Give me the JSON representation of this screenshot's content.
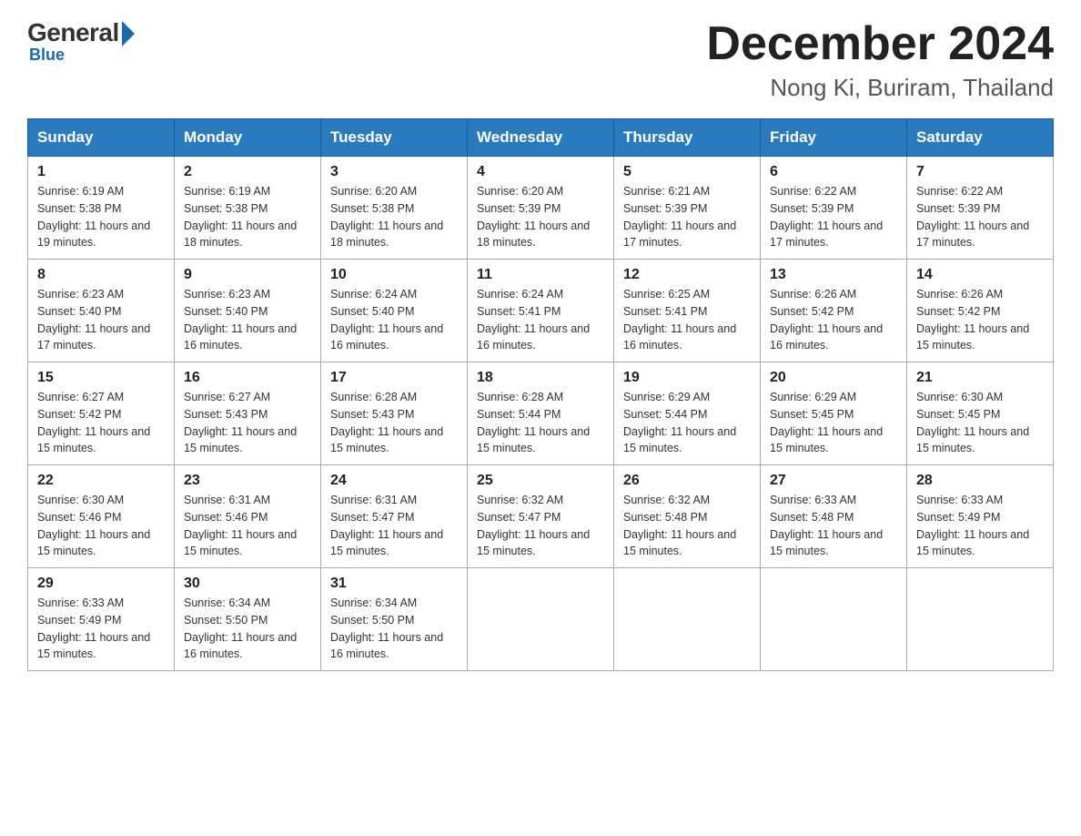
{
  "logo": {
    "general": "General",
    "blue": "Blue"
  },
  "header": {
    "month": "December 2024",
    "location": "Nong Ki, Buriram, Thailand"
  },
  "weekdays": [
    "Sunday",
    "Monday",
    "Tuesday",
    "Wednesday",
    "Thursday",
    "Friday",
    "Saturday"
  ],
  "weeks": [
    [
      {
        "day": "1",
        "sunrise": "6:19 AM",
        "sunset": "5:38 PM",
        "daylight": "11 hours and 19 minutes."
      },
      {
        "day": "2",
        "sunrise": "6:19 AM",
        "sunset": "5:38 PM",
        "daylight": "11 hours and 18 minutes."
      },
      {
        "day": "3",
        "sunrise": "6:20 AM",
        "sunset": "5:38 PM",
        "daylight": "11 hours and 18 minutes."
      },
      {
        "day": "4",
        "sunrise": "6:20 AM",
        "sunset": "5:39 PM",
        "daylight": "11 hours and 18 minutes."
      },
      {
        "day": "5",
        "sunrise": "6:21 AM",
        "sunset": "5:39 PM",
        "daylight": "11 hours and 17 minutes."
      },
      {
        "day": "6",
        "sunrise": "6:22 AM",
        "sunset": "5:39 PM",
        "daylight": "11 hours and 17 minutes."
      },
      {
        "day": "7",
        "sunrise": "6:22 AM",
        "sunset": "5:39 PM",
        "daylight": "11 hours and 17 minutes."
      }
    ],
    [
      {
        "day": "8",
        "sunrise": "6:23 AM",
        "sunset": "5:40 PM",
        "daylight": "11 hours and 17 minutes."
      },
      {
        "day": "9",
        "sunrise": "6:23 AM",
        "sunset": "5:40 PM",
        "daylight": "11 hours and 16 minutes."
      },
      {
        "day": "10",
        "sunrise": "6:24 AM",
        "sunset": "5:40 PM",
        "daylight": "11 hours and 16 minutes."
      },
      {
        "day": "11",
        "sunrise": "6:24 AM",
        "sunset": "5:41 PM",
        "daylight": "11 hours and 16 minutes."
      },
      {
        "day": "12",
        "sunrise": "6:25 AM",
        "sunset": "5:41 PM",
        "daylight": "11 hours and 16 minutes."
      },
      {
        "day": "13",
        "sunrise": "6:26 AM",
        "sunset": "5:42 PM",
        "daylight": "11 hours and 16 minutes."
      },
      {
        "day": "14",
        "sunrise": "6:26 AM",
        "sunset": "5:42 PM",
        "daylight": "11 hours and 15 minutes."
      }
    ],
    [
      {
        "day": "15",
        "sunrise": "6:27 AM",
        "sunset": "5:42 PM",
        "daylight": "11 hours and 15 minutes."
      },
      {
        "day": "16",
        "sunrise": "6:27 AM",
        "sunset": "5:43 PM",
        "daylight": "11 hours and 15 minutes."
      },
      {
        "day": "17",
        "sunrise": "6:28 AM",
        "sunset": "5:43 PM",
        "daylight": "11 hours and 15 minutes."
      },
      {
        "day": "18",
        "sunrise": "6:28 AM",
        "sunset": "5:44 PM",
        "daylight": "11 hours and 15 minutes."
      },
      {
        "day": "19",
        "sunrise": "6:29 AM",
        "sunset": "5:44 PM",
        "daylight": "11 hours and 15 minutes."
      },
      {
        "day": "20",
        "sunrise": "6:29 AM",
        "sunset": "5:45 PM",
        "daylight": "11 hours and 15 minutes."
      },
      {
        "day": "21",
        "sunrise": "6:30 AM",
        "sunset": "5:45 PM",
        "daylight": "11 hours and 15 minutes."
      }
    ],
    [
      {
        "day": "22",
        "sunrise": "6:30 AM",
        "sunset": "5:46 PM",
        "daylight": "11 hours and 15 minutes."
      },
      {
        "day": "23",
        "sunrise": "6:31 AM",
        "sunset": "5:46 PM",
        "daylight": "11 hours and 15 minutes."
      },
      {
        "day": "24",
        "sunrise": "6:31 AM",
        "sunset": "5:47 PM",
        "daylight": "11 hours and 15 minutes."
      },
      {
        "day": "25",
        "sunrise": "6:32 AM",
        "sunset": "5:47 PM",
        "daylight": "11 hours and 15 minutes."
      },
      {
        "day": "26",
        "sunrise": "6:32 AM",
        "sunset": "5:48 PM",
        "daylight": "11 hours and 15 minutes."
      },
      {
        "day": "27",
        "sunrise": "6:33 AM",
        "sunset": "5:48 PM",
        "daylight": "11 hours and 15 minutes."
      },
      {
        "day": "28",
        "sunrise": "6:33 AM",
        "sunset": "5:49 PM",
        "daylight": "11 hours and 15 minutes."
      }
    ],
    [
      {
        "day": "29",
        "sunrise": "6:33 AM",
        "sunset": "5:49 PM",
        "daylight": "11 hours and 15 minutes."
      },
      {
        "day": "30",
        "sunrise": "6:34 AM",
        "sunset": "5:50 PM",
        "daylight": "11 hours and 16 minutes."
      },
      {
        "day": "31",
        "sunrise": "6:34 AM",
        "sunset": "5:50 PM",
        "daylight": "11 hours and 16 minutes."
      },
      null,
      null,
      null,
      null
    ]
  ]
}
